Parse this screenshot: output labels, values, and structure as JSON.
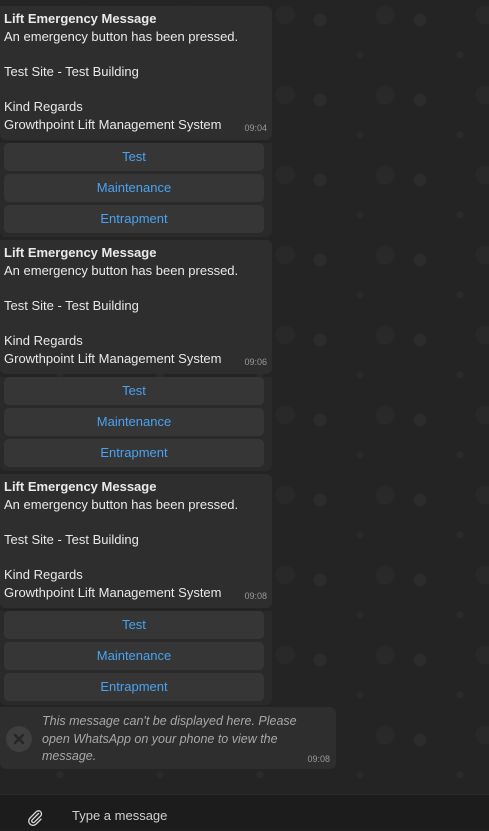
{
  "messages": [
    {
      "title": "Lift Emergency Message",
      "line1": "An emergency button has been pressed.",
      "site": "Test Site - Test Building",
      "regards": "Kind Regards",
      "signature": "Growthpoint Lift Management System",
      "time": "09:04",
      "buttons": [
        "Test",
        "Maintenance",
        "Entrapment"
      ]
    },
    {
      "title": "Lift Emergency Message",
      "line1": "An emergency button has been pressed.",
      "site": "Test Site - Test Building",
      "regards": "Kind Regards",
      "signature": "Growthpoint Lift Management System",
      "time": "09:06",
      "buttons": [
        "Test",
        "Maintenance",
        "Entrapment"
      ]
    },
    {
      "title": "Lift Emergency Message",
      "line1": "An emergency button has been pressed.",
      "site": "Test Site - Test Building",
      "regards": "Kind Regards",
      "signature": "Growthpoint Lift Management System",
      "time": "09:08",
      "buttons": [
        "Test",
        "Maintenance",
        "Entrapment"
      ]
    }
  ],
  "unsupported": {
    "text": "This message can't be displayed here. Please open WhatsApp on your phone to view the message.",
    "time": "09:08",
    "icon": "blocked-icon"
  },
  "composer": {
    "placeholder": "Type a message",
    "attach_icon": "paperclip-icon"
  },
  "colors": {
    "button_text": "#4aa3f0",
    "bubble_bg": "#2e2e2e",
    "chat_bg": "#242424"
  }
}
